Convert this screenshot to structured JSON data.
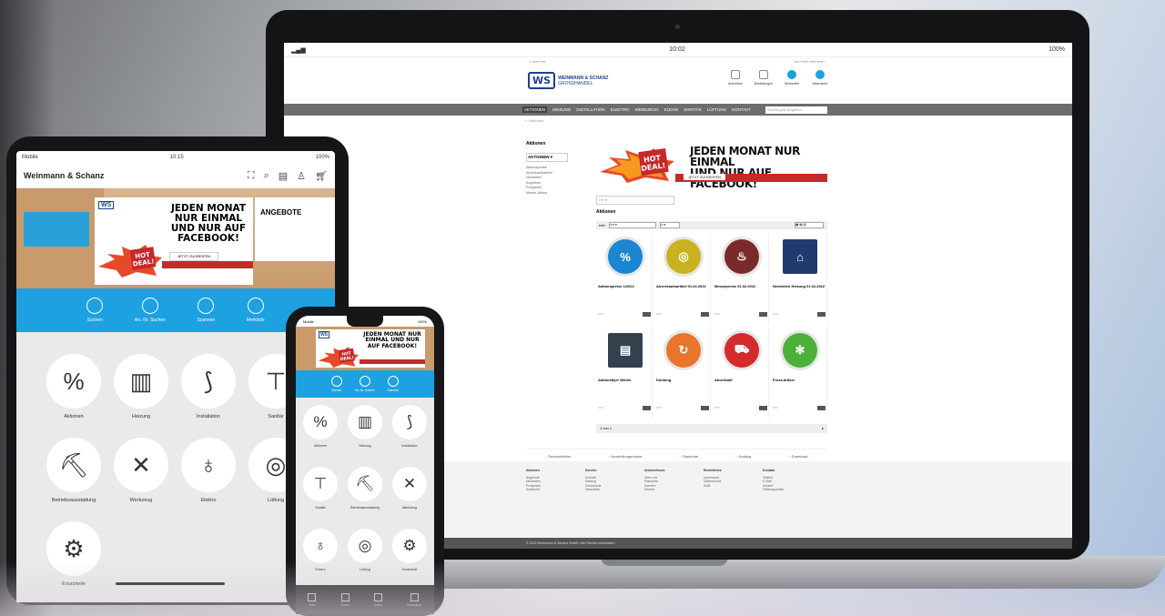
{
  "laptop": {
    "status_time": "10:02",
    "status_battery": "100%",
    "logo_mark": "WS",
    "logo_text": "WEINMANN & SCHANZ",
    "logo_sub": "GROSSHANDEL",
    "header_icons": [
      "Anmelden",
      "Bestellungen",
      "Merkzettel",
      "Warenkorb"
    ],
    "nav": [
      "AKTIONEN",
      "HEIZUNG",
      "INSTALLATION",
      "ELEKTRO",
      "WERKZEUG",
      "KÜCHE",
      "SANITÄR",
      "LÜFTUNG",
      "KONTAKT"
    ],
    "search_placeholder": "Suchbegriff eingeben",
    "sidebar_title": "Aktionen",
    "sidebar_box": "AKTIONEN",
    "sidebar_items": [
      "Aktionspreise",
      "Abverkaufsartikel",
      "Neuheiten",
      "Angebote",
      "Prospekte",
      "Messe-Aktion"
    ],
    "banner_line1": "JEDEN MONAT NUR EINMAL",
    "banner_line2": "UND NUR AUF FACEBOOK!",
    "banner_btn": "JETZT ZUGREIFEN",
    "hotdeal": "HOT DEAL!",
    "products_label": "Aktionen",
    "pager": "1 von 1",
    "products": [
      {
        "title": "Aktionspreise 1/2022",
        "color": "#1c86d1",
        "glyph": "%",
        "shape": "circle"
      },
      {
        "title": "Abverkaufsartikel 01.02.2022",
        "color": "#c9b21f",
        "glyph": "◎",
        "shape": "circle"
      },
      {
        "title": "Messepreise 01.02.2022",
        "color": "#7a2a2a",
        "glyph": "♨",
        "shape": "circle"
      },
      {
        "title": "Neuheiten Heizung 01.02.2022",
        "color": "#223a6d",
        "glyph": "⌂",
        "shape": "square"
      },
      {
        "title": "Aktionsflyer Winter",
        "color": "#35404f",
        "glyph": "▤",
        "shape": "square"
      },
      {
        "title": "Kühlung",
        "color": "#e8752b",
        "glyph": "↻",
        "shape": "circle"
      },
      {
        "title": "Abverkauf",
        "color": "#d42b2b",
        "glyph": "⛟",
        "shape": "circle"
      },
      {
        "title": "Frost-Artikel",
        "color": "#4caf3a",
        "glyph": "✻",
        "shape": "circle"
      }
    ],
    "service": [
      "Servicetelefon",
      "Ausstellungsräume",
      "Standorte",
      "Katalog",
      "Download"
    ],
    "footer_cols": [
      {
        "h": "Aktionen",
        "items": [
          "Angebote",
          "Neuheiten",
          "Prospekte",
          "Sortiment"
        ]
      },
      {
        "h": "Service",
        "items": [
          "Kontakt",
          "Katalog",
          "Downloads",
          "Newsletter"
        ]
      },
      {
        "h": "Unternehmen",
        "items": [
          "Über uns",
          "Standorte",
          "Karriere",
          "Partner"
        ]
      },
      {
        "h": "Rechtliches",
        "items": [
          "Impressum",
          "Datenschutz",
          "AGB"
        ]
      },
      {
        "h": "Kontakt",
        "items": [
          "Telefon",
          "E-Mail",
          "Anfahrt",
          "Öffnungszeiten"
        ]
      }
    ],
    "copyright": "© 2022 Weinmann & Schanz GmbH. Alle Rechte vorbehalten"
  },
  "tablet": {
    "status_left": "Mobile",
    "status_time": "10:15",
    "status_right": "100%",
    "title": "Weinmann & Schanz",
    "banner_text": "JEDEN MONAT NUR EINMAL UND NUR AUF FACEBOOK!",
    "banner_btn": "JETZT ZUGREIFEN",
    "banner_right": "ANGEBOTE",
    "hotdeal": "HOT DEAL!",
    "logo_mark": "WS",
    "quick": [
      "Suchen",
      "Art.-Nr. Suchen",
      "Scannen",
      "Merkliste"
    ],
    "categories": [
      {
        "label": "Aktionen",
        "glyph": "%"
      },
      {
        "label": "Heizung",
        "glyph": "▥"
      },
      {
        "label": "Installation",
        "glyph": "⟆"
      },
      {
        "label": "Sanitär",
        "glyph": "⊤"
      },
      {
        "label": "Betriebsausstattung",
        "glyph": "⛏"
      },
      {
        "label": "Werkzeug",
        "glyph": "✕"
      },
      {
        "label": "Elektro",
        "glyph": "♁"
      },
      {
        "label": "Lüftung",
        "glyph": "◎"
      },
      {
        "label": "Ersatzteile",
        "glyph": "⚙"
      }
    ]
  },
  "phone": {
    "status_left": "Mobile",
    "status_right": "100%",
    "banner_text": "JEDEN MONAT NUR EINMAL UND NUR AUF FACEBOOK!",
    "logo_mark": "WS",
    "hotdeal": "HOT DEAL!",
    "quick": [
      "Suchen",
      "Art.-Nr. Suchen",
      "Scannen"
    ],
    "categories": [
      {
        "label": "Aktionen",
        "glyph": "%"
      },
      {
        "label": "Heizung",
        "glyph": "▥"
      },
      {
        "label": "Installation",
        "glyph": "⟆"
      },
      {
        "label": "Sanitär",
        "glyph": "⊤"
      },
      {
        "label": "Betriebsausstattung",
        "glyph": "⛏"
      },
      {
        "label": "Werkzeug",
        "glyph": "✕"
      },
      {
        "label": "Elektro",
        "glyph": "♁"
      },
      {
        "label": "Lüftung",
        "glyph": "◎"
      },
      {
        "label": "Ersatzteile",
        "glyph": "⚙"
      }
    ],
    "tabs": [
      "Start",
      "Suche",
      "Konto",
      "Warenkorb"
    ]
  }
}
